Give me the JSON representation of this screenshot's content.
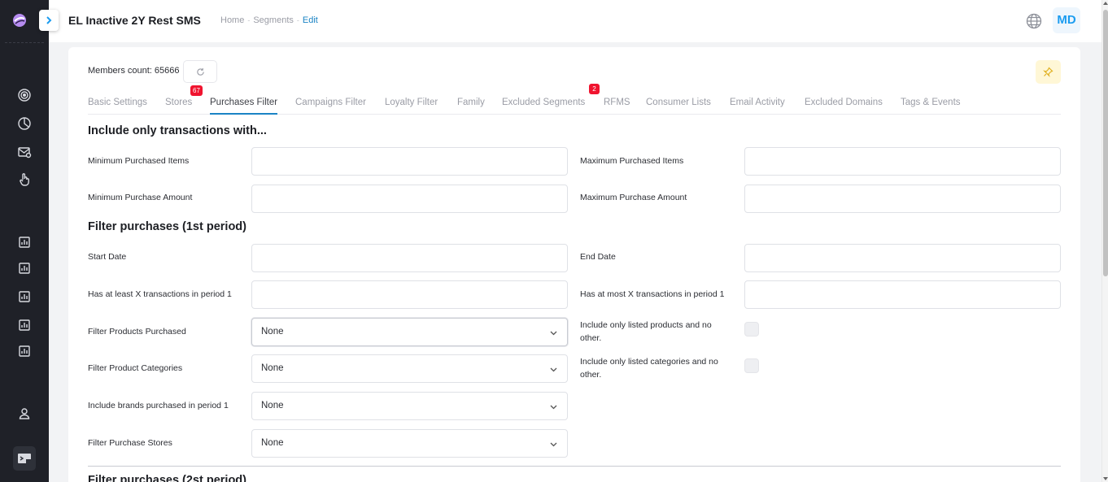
{
  "app": {
    "title": "EL Inactive 2Y Rest SMS",
    "avatar_initials": "MD",
    "accent_color": "#1b84c5"
  },
  "breadcrumb": {
    "home": "Home",
    "segments": "Segments",
    "edit": "Edit"
  },
  "sidebar": {
    "icons": [
      "target-icon",
      "pie-chart-icon",
      "mail-settings-icon",
      "hand-pointer-icon",
      "report-icon",
      "report-icon",
      "report-icon",
      "report-icon",
      "report-icon",
      "user-icon",
      "terminal-icon"
    ]
  },
  "members": {
    "label": "Members count: 65666"
  },
  "tabs": [
    {
      "label": "Basic Settings",
      "active": false
    },
    {
      "label": "Stores",
      "active": false,
      "badge": "67"
    },
    {
      "label": "Purchases Filter",
      "active": true
    },
    {
      "label": "Campaigns Filter",
      "active": false
    },
    {
      "label": "Loyalty Filter",
      "active": false
    },
    {
      "label": "Family",
      "active": false
    },
    {
      "label": "Excluded Segments",
      "active": false,
      "badge": "2"
    },
    {
      "label": "RFMS",
      "active": false
    },
    {
      "label": "Consumer Lists",
      "active": false
    },
    {
      "label": "Email Activity",
      "active": false
    },
    {
      "label": "Excluded Domains",
      "active": false
    },
    {
      "label": "Tags & Events",
      "active": false
    }
  ],
  "section1": {
    "title": "Include only transactions with...",
    "min_items": {
      "label": "Minimum Purchased Items",
      "value": ""
    },
    "max_items": {
      "label": "Maximum Purchased Items",
      "value": ""
    },
    "min_amount": {
      "label": "Minimum Purchase Amount",
      "value": ""
    },
    "max_amount": {
      "label": "Maximum Purchase Amount",
      "value": ""
    }
  },
  "section2": {
    "title": "Filter purchases (1st period)",
    "start_date": {
      "label": "Start Date",
      "value": ""
    },
    "end_date": {
      "label": "End Date",
      "value": ""
    },
    "at_least": {
      "label": "Has at least X transactions in period 1",
      "value": ""
    },
    "at_most": {
      "label": "Has at most X transactions in period 1",
      "value": ""
    },
    "products": {
      "label": "Filter Products Purchased",
      "value": "None"
    },
    "only_products": {
      "label": "Include only listed products and no other.",
      "checked": false
    },
    "categories": {
      "label": "Filter Product Categories",
      "value": "None"
    },
    "only_categories": {
      "label": "Include only listed categories and no other.",
      "checked": false
    },
    "brands": {
      "label": "Include brands purchased in period 1",
      "value": "None"
    },
    "stores": {
      "label": "Filter Purchase Stores",
      "value": "None"
    }
  },
  "section3": {
    "title": "Filter purchases (2st period)"
  }
}
